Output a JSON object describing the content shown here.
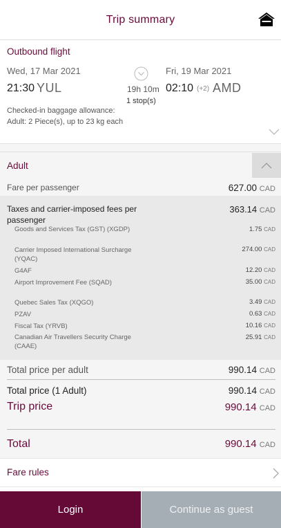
{
  "header": {
    "title": "Trip summary",
    "home_icon": "home-icon"
  },
  "outbound": {
    "title": "Outbound flight",
    "departure": {
      "date": "Wed, 17 Mar 2021",
      "time": "21:30",
      "code": "YUL"
    },
    "arrival": {
      "date": "Fri, 19 Mar 2021",
      "time": "02:10",
      "day_offset": "(+2)",
      "code": "AMD"
    },
    "duration": "19h 10m",
    "stops": "1 stop(s)",
    "baggage_line1": "Checked-in baggage allowance:",
    "baggage_line2": "Adult: 2 Piece(s), up to 23 kg each"
  },
  "adult": {
    "label": "Adult",
    "fare_label": "Fare per passenger",
    "fare_value": "627.00",
    "taxes_label": "Taxes and carrier-imposed fees per passenger",
    "taxes_value": "363.14",
    "tax_items": [
      {
        "name": "Goods and Services Tax (GST) (XGDP)",
        "amount": "1.75"
      },
      {
        "name": "Carrier Imposed International Surcharge (YQAC)",
        "amount": "274.00"
      },
      {
        "name": "G4AF",
        "amount": "12.20"
      },
      {
        "name": "Airport Improvement Fee (SQAD)",
        "amount": "35.00"
      },
      {
        "name": "Quebec Sales Tax (XQGO)",
        "amount": "3.49"
      },
      {
        "name": "PZAV",
        "amount": "0.63"
      },
      {
        "name": "Fiscal Tax (YRVB)",
        "amount": "10.16"
      },
      {
        "name": "Canadian Air Travellers Security Charge (CAAE)",
        "amount": "25.91"
      }
    ],
    "total_per_adult_label": "Total price per adult",
    "total_per_adult_value": "990.14"
  },
  "summary": {
    "total_price_label": "Total price (1 Adult)",
    "total_price_value": "990.14",
    "trip_price_label": "Trip price",
    "trip_price_value": "990.14",
    "total_label": "Total",
    "total_value": "990.14"
  },
  "currency": "CAD",
  "fare_rules_label": "Fare rules",
  "buttons": {
    "login": "Login",
    "guest": "Continue as guest"
  },
  "colors": {
    "brand": "#6a0a3a",
    "login_bg": "#650a37",
    "guest_bg": "#a6aeb5"
  }
}
